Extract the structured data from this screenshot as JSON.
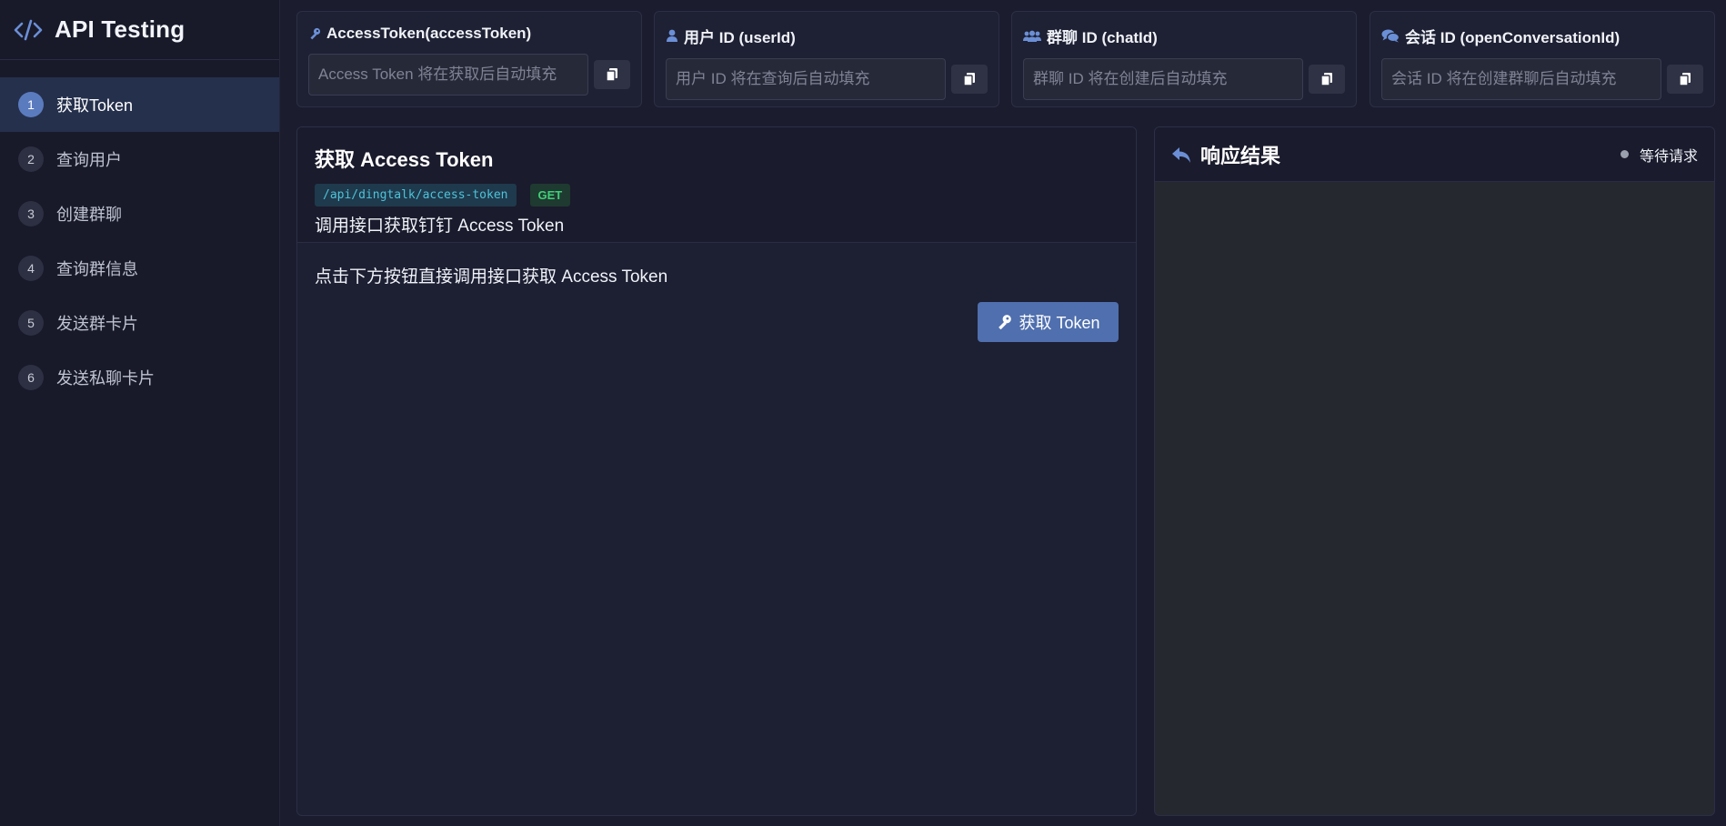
{
  "brand": {
    "title": "API Testing"
  },
  "nav": {
    "items": [
      {
        "num": "1",
        "label": "获取Token"
      },
      {
        "num": "2",
        "label": "查询用户"
      },
      {
        "num": "3",
        "label": "创建群聊"
      },
      {
        "num": "4",
        "label": "查询群信息"
      },
      {
        "num": "5",
        "label": "发送群卡片"
      },
      {
        "num": "6",
        "label": "发送私聊卡片"
      }
    ]
  },
  "ids": [
    {
      "label": "AccessToken(accessToken)",
      "placeholder": "Access Token 将在获取后自动填充",
      "value": ""
    },
    {
      "label": "用户 ID (userId)",
      "placeholder": "用户 ID 将在查询后自动填充",
      "value": ""
    },
    {
      "label": "群聊 ID (chatId)",
      "placeholder": "群聊 ID 将在创建后自动填充",
      "value": ""
    },
    {
      "label": "会话 ID (openConversationId)",
      "placeholder": "会话 ID 将在创建群聊后自动填充",
      "value": ""
    }
  ],
  "panel": {
    "title": "获取 Access Token",
    "endpoint": "/api/dingtalk/access-token",
    "method": "GET",
    "description": "调用接口获取钉钉 Access Token",
    "instruction": "点击下方按钮直接调用接口获取 Access Token",
    "button_label": "获取 Token"
  },
  "response": {
    "title": "响应结果",
    "status": "等待请求",
    "body": ""
  },
  "colors": {
    "accent": "#4f6fae",
    "active_nav": "#25304c",
    "endpoint_text": "#4fc3d9",
    "method_text": "#3fcf78"
  },
  "icons": {
    "brand": "code-icon",
    "access_token": "key-icon",
    "user": "user-icon",
    "chat": "users-icon",
    "conversation": "comments-icon",
    "copy": "copy-icon",
    "response": "reply-icon"
  }
}
